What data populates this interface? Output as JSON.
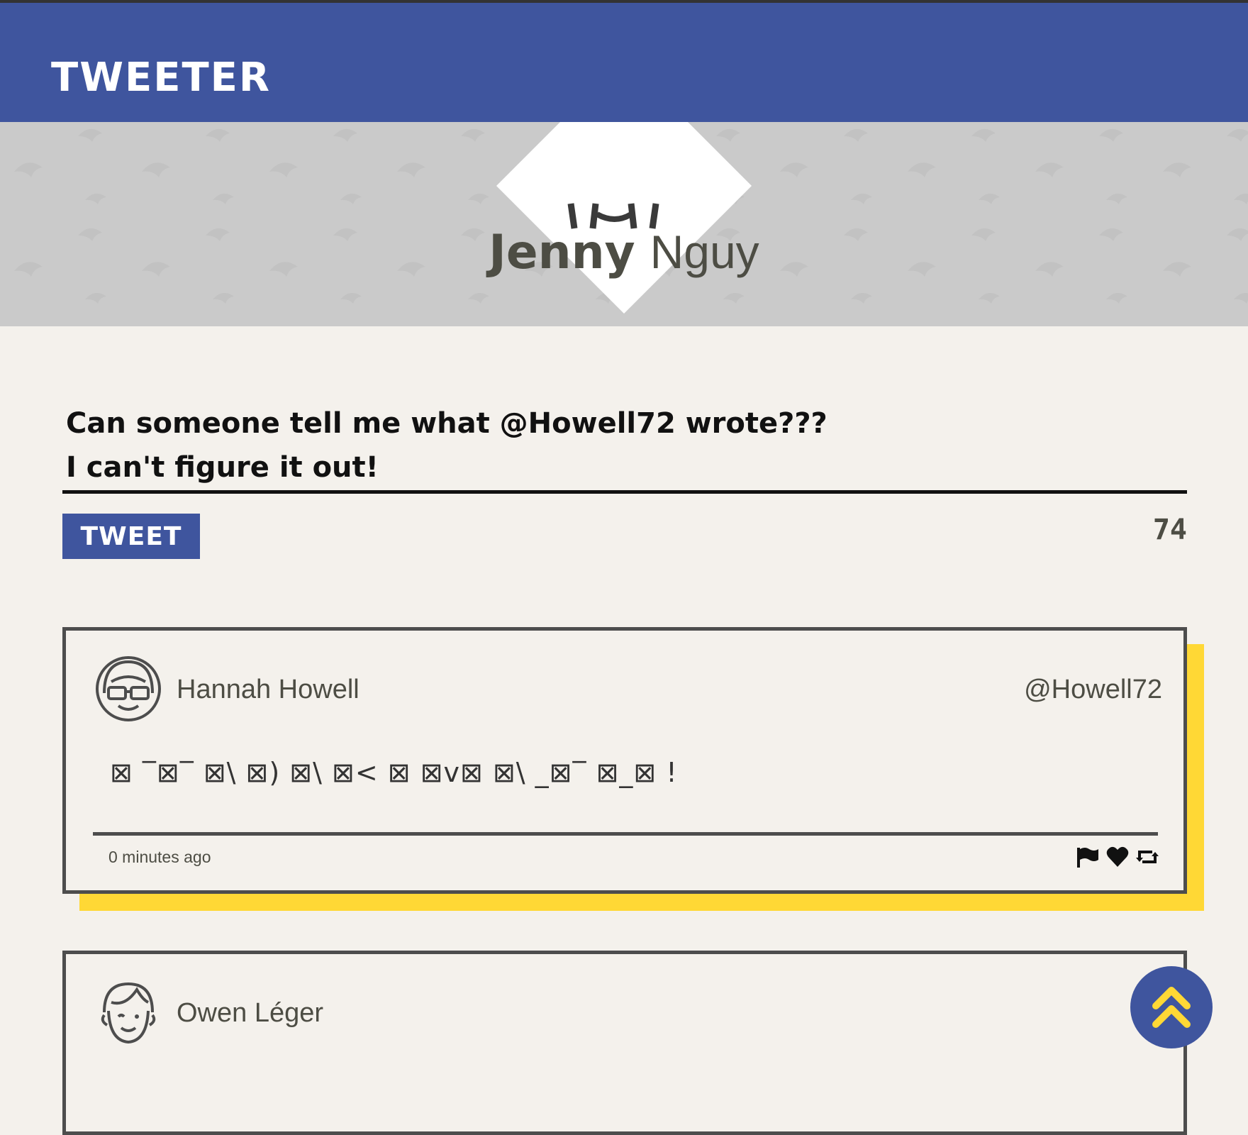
{
  "navbar": {
    "brand": "TWEETER"
  },
  "profile": {
    "first_name": "Jenny",
    "last_name": "Nguy"
  },
  "composer": {
    "text": "Can someone tell me what @Howell72 wrote???\nI can't figure it out!",
    "button_label": "TWEET",
    "char_count": "74"
  },
  "tweets": [
    {
      "name": "Hannah Howell",
      "handle": "@Howell72",
      "body": "⊠ ‾⊠‾ ⊠\\ ⊠) ⊠\\ ⊠< ⊠ ⊠v⊠ ⊠\\ _⊠‾ ⊠_⊠ !",
      "time": "0 minutes ago",
      "actions": [
        "flag-icon",
        "heart-icon",
        "retweet-icon"
      ]
    },
    {
      "name": "Owen Léger"
    }
  ],
  "colors": {
    "primary": "#3f559e",
    "accent": "#ffd835",
    "background": "#f4f1ec",
    "hero": "#cacaca"
  }
}
